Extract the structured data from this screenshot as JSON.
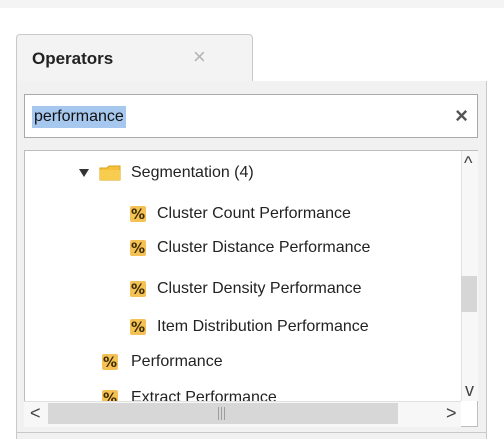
{
  "panel": {
    "tab_title": "Operators",
    "tab_close": "×"
  },
  "search": {
    "value": "performance",
    "clear_icon": "×"
  },
  "tree": {
    "folder": {
      "label": "Segmentation (4)",
      "icon": "folder-icon",
      "expanded": true
    },
    "children": [
      {
        "label": "Cluster Count Performance",
        "icon": "operator-percent-icon"
      },
      {
        "label": "Cluster Distance Performance",
        "icon": "operator-percent-icon"
      },
      {
        "label": "Cluster Density Performance",
        "icon": "operator-percent-icon"
      },
      {
        "label": "Item Distribution Performance",
        "icon": "operator-percent-icon"
      }
    ],
    "top_level": [
      {
        "label": "Performance",
        "icon": "operator-percent-icon"
      },
      {
        "label": "Extract Performance",
        "icon": "operator-percent-icon"
      }
    ]
  },
  "scrollbars": {
    "up_arrow": "^",
    "down_arrow": "v",
    "left_arrow": "<",
    "right_arrow": ">"
  },
  "colors": {
    "folder": "#f5c13b",
    "operator_icon_bg": "#e5a72a",
    "selection": "#a7c8ee"
  }
}
